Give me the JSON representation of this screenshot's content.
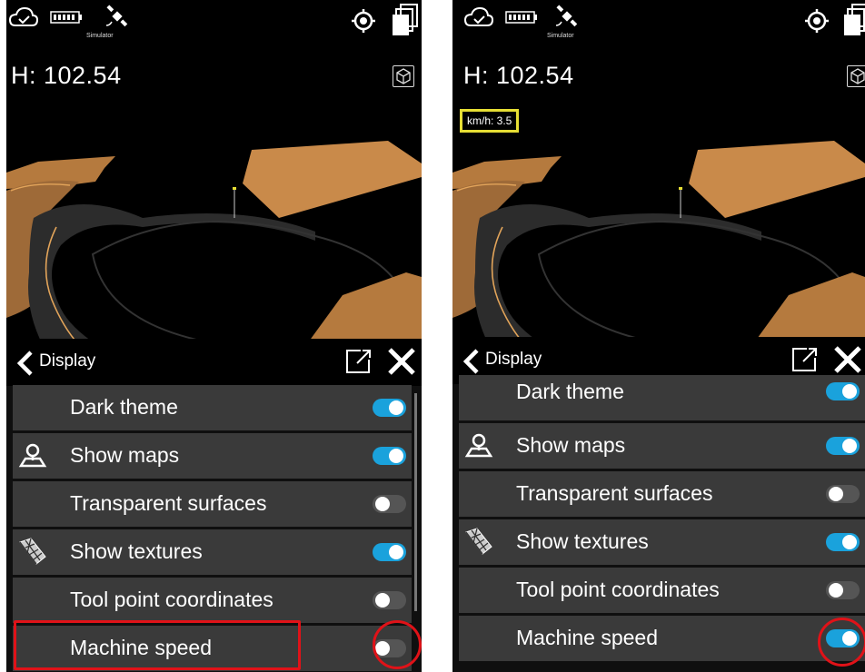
{
  "status": {
    "simulator_label": "Simulator"
  },
  "height_readout": "H: 102.54",
  "speed_readout": "km/h: 3.5",
  "panel": {
    "title": "Display"
  },
  "rows": [
    {
      "label": "Dark theme",
      "icon": "none"
    },
    {
      "label": "Show maps",
      "icon": "map-pin-icon"
    },
    {
      "label": "Transparent surfaces",
      "icon": "none"
    },
    {
      "label": "Show textures",
      "icon": "texture-mesh-icon"
    },
    {
      "label": "Tool point coordinates",
      "icon": "none"
    },
    {
      "label": "Machine speed",
      "icon": "none"
    }
  ],
  "left_screen_toggles": [
    true,
    true,
    false,
    true,
    false,
    false
  ],
  "right_screen_toggles": [
    true,
    true,
    false,
    true,
    false,
    true
  ],
  "colors": {
    "toggle_on": "#1aa2dc",
    "toggle_off": "#555555",
    "highlight": "#e01218",
    "speed_box_border": "#e6de34",
    "surface_orange": "#c98a4a"
  }
}
